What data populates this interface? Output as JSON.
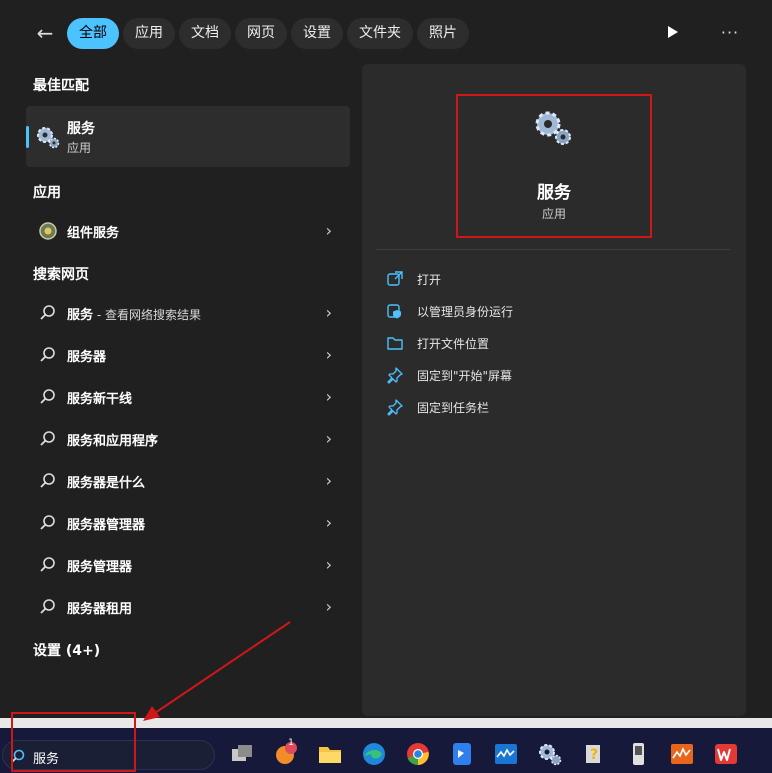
{
  "filters": {
    "back_label": "←",
    "tabs": [
      {
        "label": "全部",
        "active": true
      },
      {
        "label": "应用",
        "active": false
      },
      {
        "label": "文档",
        "active": false
      },
      {
        "label": "网页",
        "active": false
      },
      {
        "label": "设置",
        "active": false
      },
      {
        "label": "文件夹",
        "active": false
      },
      {
        "label": "照片",
        "active": false
      }
    ],
    "more_label": "···"
  },
  "results": {
    "best_match_heading": "最佳匹配",
    "best_match": {
      "title": "服务",
      "subtitle": "应用"
    },
    "apps_heading": "应用",
    "apps": [
      {
        "label": "组件服务"
      }
    ],
    "web_heading": "搜索网页",
    "web": [
      {
        "label": "服务",
        "suffix": " - 查看网络搜索结果"
      },
      {
        "label": "服务器",
        "suffix": ""
      },
      {
        "label": "服务新干线",
        "suffix": ""
      },
      {
        "label": "服务和应用程序",
        "suffix": ""
      },
      {
        "label": "服务器是什么",
        "suffix": ""
      },
      {
        "label": "服务器管理器",
        "suffix": ""
      },
      {
        "label": "服务管理器",
        "suffix": ""
      },
      {
        "label": "服务器租用",
        "suffix": ""
      }
    ],
    "settings_heading": "设置 (4+)"
  },
  "preview": {
    "title": "服务",
    "subtitle": "应用",
    "actions": [
      {
        "label": "打开",
        "icon": "open-external-icon"
      },
      {
        "label": "以管理员身份运行",
        "icon": "admin-shield-icon"
      },
      {
        "label": "打开文件位置",
        "icon": "folder-icon"
      },
      {
        "label": "固定到\"开始\"屏幕",
        "icon": "pin-icon"
      },
      {
        "label": "固定到任务栏",
        "icon": "pin-icon"
      }
    ]
  },
  "taskbar": {
    "search_text": "服务",
    "notification_badge": "1"
  },
  "colors": {
    "accent": "#4cc2ff",
    "highlight": "#d01717"
  }
}
